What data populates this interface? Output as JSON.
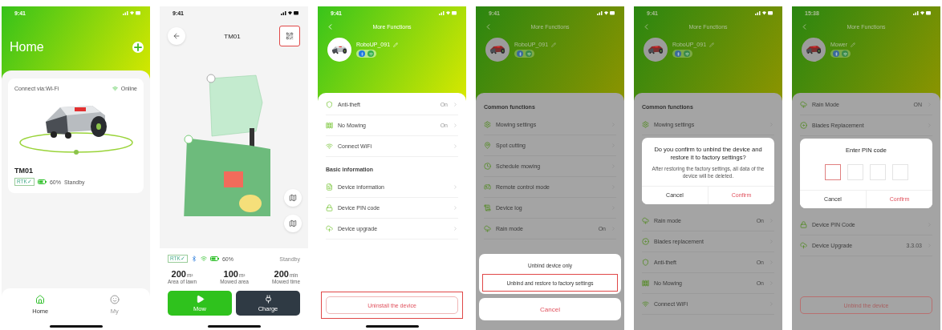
{
  "screens": [
    {
      "kind": "home",
      "time": "9:41",
      "title": "Home",
      "card": {
        "connection": "Connect via:Wi-Fi",
        "status": "Online",
        "name": "TM01",
        "rtk": "RTK✓",
        "battery": "60%",
        "state": "Standby"
      },
      "tabs": [
        {
          "label": "Home",
          "selected": true
        },
        {
          "label": "My",
          "selected": false
        }
      ]
    },
    {
      "kind": "map",
      "time": "9:41",
      "title": "TM01",
      "map_button": {
        "highlighted": true
      },
      "status": {
        "rtk": "RTK✓",
        "battery": "60%",
        "state": "Standby"
      },
      "stats": [
        {
          "value": "200",
          "unit": "m²",
          "label": "Area of lawn"
        },
        {
          "value": "100",
          "unit": "m²",
          "label": "Mowed area"
        },
        {
          "value": "200",
          "unit": "min",
          "label": "Mowed time"
        }
      ],
      "actions": [
        {
          "kind": "mow",
          "label": "Mow"
        },
        {
          "kind": "charge",
          "label": "Charge"
        }
      ]
    },
    {
      "kind": "functions",
      "time": "9:41",
      "title": "More Functions",
      "device": "RoboUP_091",
      "dimmed": false,
      "blocks": [
        {
          "kind": "anti_theft",
          "label": "Anti-theft",
          "value": "On"
        },
        {
          "kind": "no_mowing",
          "label": "No Mowing",
          "value": "On"
        },
        {
          "kind": "wifi",
          "label": "Connect WiFi"
        },
        {
          "kind": "heading",
          "text": "Basic information"
        },
        {
          "kind": "info",
          "label": "Device information"
        },
        {
          "kind": "pin",
          "label": "Device PIN code"
        },
        {
          "kind": "upgrade",
          "label": "Device upgrade"
        }
      ],
      "footer_button": {
        "label": "Uninstall the device",
        "highlighted": true
      }
    },
    {
      "kind": "functions",
      "time": "9:41",
      "title": "More Functions",
      "device": "RoboUP_091",
      "dimmed": true,
      "blocks": [
        {
          "kind": "heading",
          "text": "Common functions"
        },
        {
          "kind": "settings",
          "label": "Mowing settings"
        },
        {
          "kind": "spot",
          "label": "Spot cutting"
        },
        {
          "kind": "schedule",
          "label": "Schedule mowing"
        },
        {
          "kind": "remote",
          "label": "Remote control mode"
        },
        {
          "kind": "log",
          "label": "Device log"
        },
        {
          "kind": "rain",
          "label": "Rain mode",
          "value": "On"
        }
      ],
      "sheet": {
        "options": [
          {
            "label": "Unbind device only",
            "highlighted": false
          },
          {
            "label": "Unbind and restore to factory settings",
            "highlighted": true
          }
        ],
        "cancel": "Cancel"
      }
    },
    {
      "kind": "functions",
      "time": "9:41",
      "title": "More Functions",
      "device": "RoboUP_091",
      "dimmed": true,
      "blocks": [
        {
          "kind": "heading",
          "text": "Common functions"
        },
        {
          "kind": "settings",
          "label": "Mowing settings"
        },
        {
          "kind": "dialog",
          "title": "Do you confirm to unbind the device and restore it to factory settings?",
          "message": "After restoring the factory settings, all data of the device will be deleted.",
          "buttons": [
            {
              "kind": "cancel",
              "label": "Cancel"
            },
            {
              "kind": "confirm",
              "label": "Confirm"
            }
          ]
        },
        {
          "kind": "rain",
          "label": "Rain mode",
          "value": "On"
        },
        {
          "kind": "blades",
          "label": "Blades replacement"
        },
        {
          "kind": "anti_theft",
          "label": "Anti-theft",
          "value": "On"
        },
        {
          "kind": "no_mowing",
          "label": "No Mowing",
          "value": "On"
        },
        {
          "kind": "wifi",
          "label": "Connect WiFi"
        }
      ]
    },
    {
      "kind": "functions",
      "time": "15:38",
      "title": "More Functions",
      "device": "Mower",
      "dimmed": true,
      "blocks": [
        {
          "kind": "rain",
          "label": "Rain Mode",
          "value": "ON"
        },
        {
          "kind": "blades",
          "label": "Blades Replacement"
        },
        {
          "kind": "dialog",
          "title": "Enter PIN code",
          "pin_boxes": [
            {
              "selected": true
            },
            {
              "selected": false
            },
            {
              "selected": false
            },
            {
              "selected": false
            }
          ],
          "buttons": [
            {
              "kind": "cancel",
              "label": "Cancel"
            },
            {
              "kind": "confirm",
              "label": "Confirm"
            }
          ]
        },
        {
          "kind": "pin",
          "label": "Device PIN Code"
        },
        {
          "kind": "upgrade",
          "label": "Device Upgrade",
          "value": "3.3.03"
        }
      ],
      "footer_button": {
        "label": "Unbind the device",
        "highlighted": false
      }
    }
  ]
}
